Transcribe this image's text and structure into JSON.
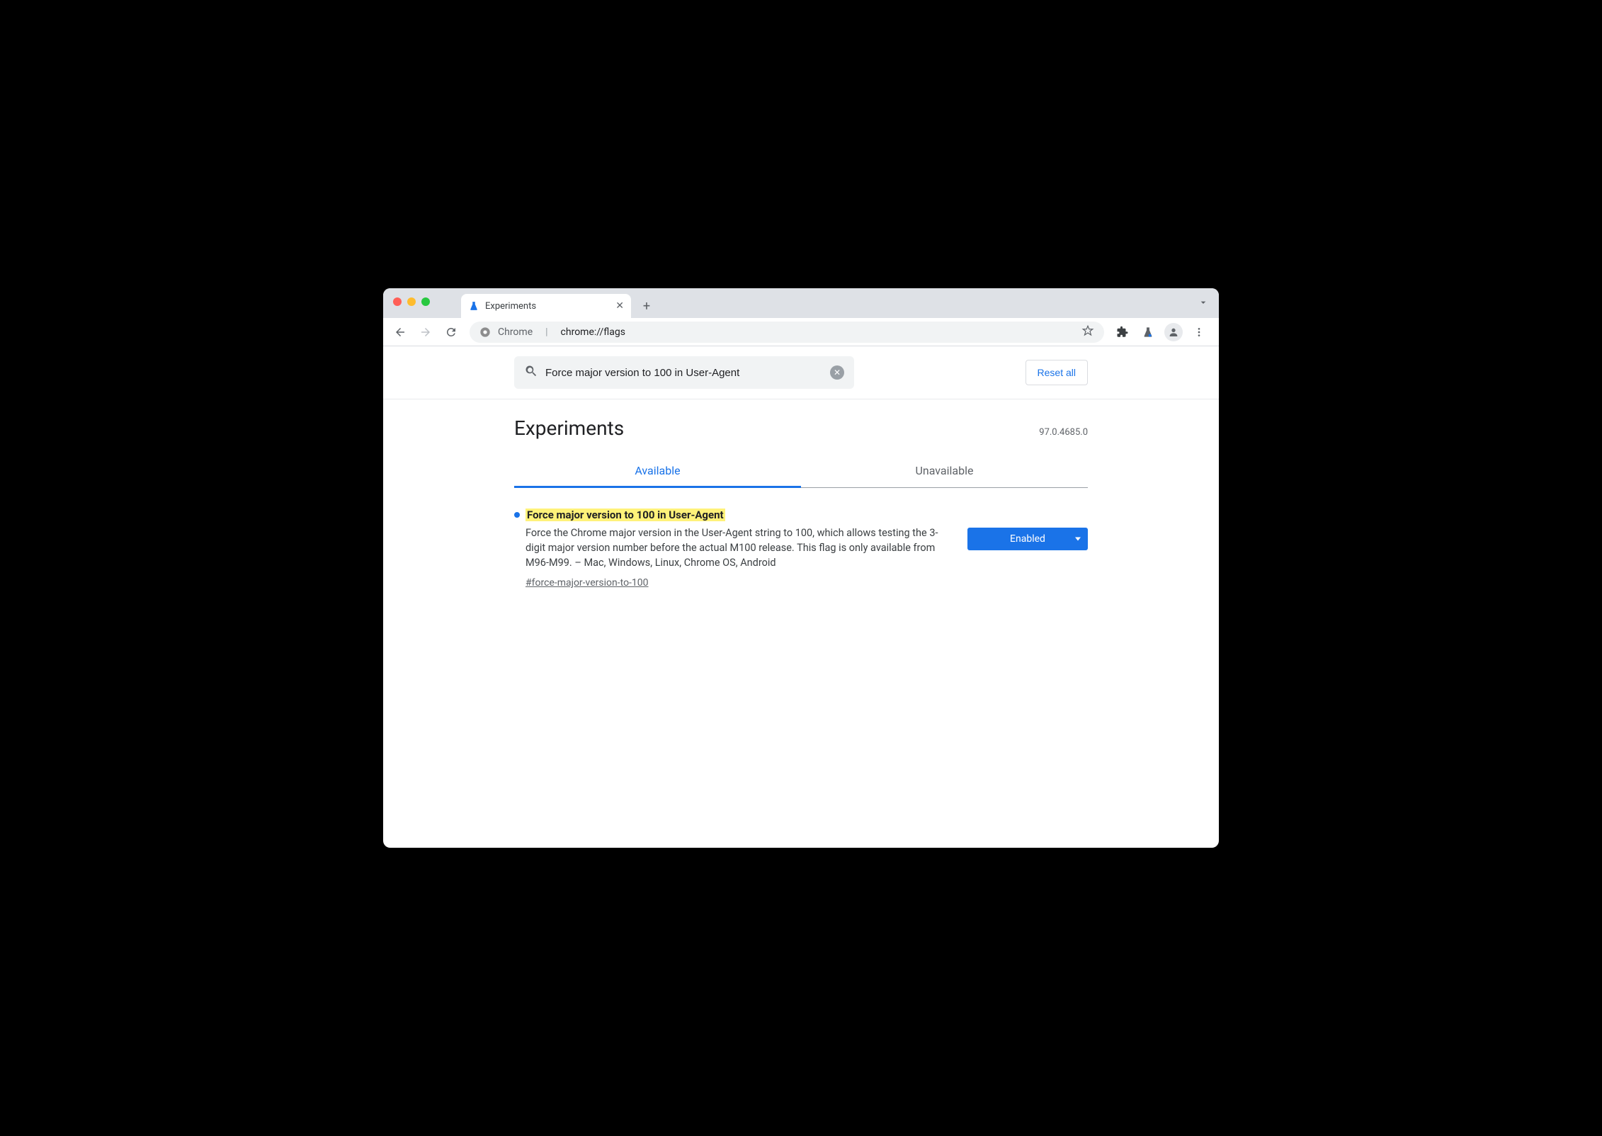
{
  "window": {
    "tab_title": "Experiments"
  },
  "address_bar": {
    "chrome_label": "Chrome",
    "url_path": "chrome://flags"
  },
  "search": {
    "value": "Force major version to 100 in User-Agent",
    "reset_label": "Reset all"
  },
  "header": {
    "title": "Experiments",
    "version": "97.0.4685.0"
  },
  "tabs": {
    "available": "Available",
    "unavailable": "Unavailable"
  },
  "experiment": {
    "title": "Force major version to 100 in User-Agent",
    "description": "Force the Chrome major version in the User-Agent string to 100, which allows testing the 3-digit major version number before the actual M100 release. This flag is only available from M96-M99. – Mac, Windows, Linux, Chrome OS, Android",
    "hash": "#force-major-version-to-100",
    "select_value": "Enabled"
  }
}
